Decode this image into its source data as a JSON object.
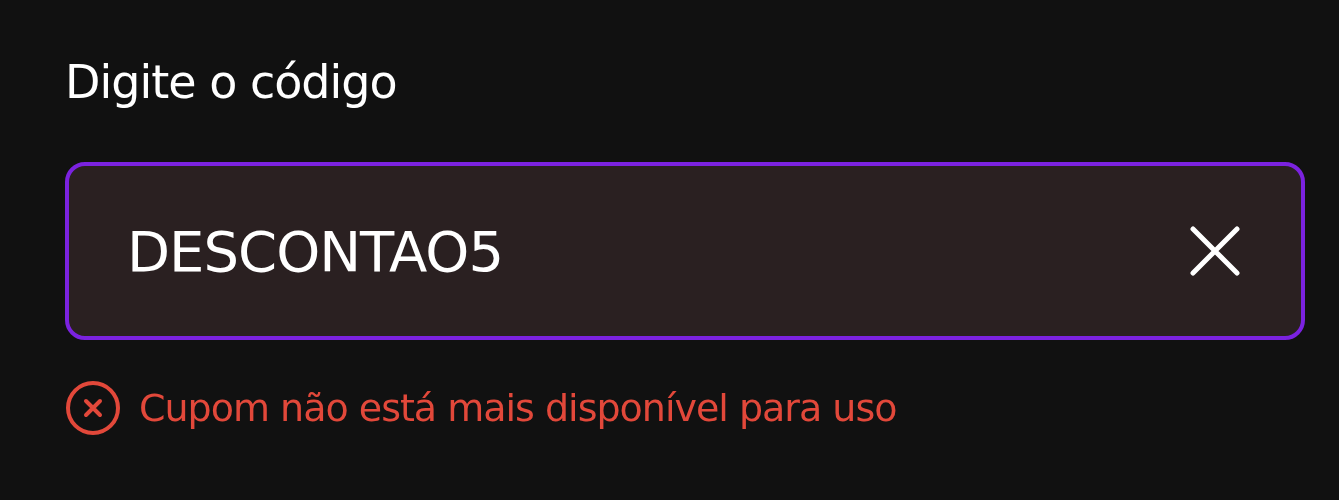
{
  "label": "Digite o código",
  "field": {
    "value": "DESCONTAO5",
    "focused": true
  },
  "error": {
    "message": "Cupom não está mais disponível para uso"
  }
}
